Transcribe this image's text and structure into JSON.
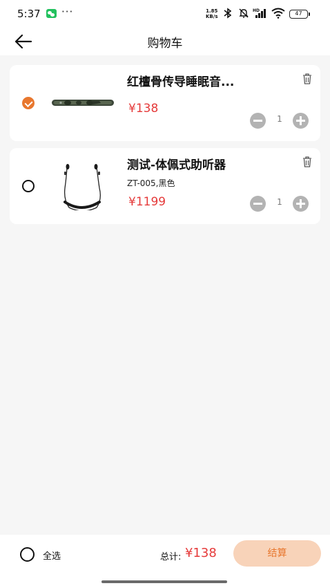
{
  "status_bar": {
    "time": "5:37",
    "more": "···",
    "net_speed_value": "1.85",
    "net_speed_unit": "KB/s",
    "battery": "47",
    "icons": [
      "wechat-icon",
      "bluetooth-icon",
      "mute-icon",
      "signal-hd-icon",
      "wifi-icon",
      "battery-icon"
    ]
  },
  "header": {
    "title": "购物车",
    "back_icon": "arrow-left-icon"
  },
  "cart": {
    "items": [
      {
        "title": "红檀骨传导睡眠音...",
        "spec": "",
        "price": "¥138",
        "quantity": "1",
        "checked": true,
        "image": "bone-conduction-headband"
      },
      {
        "title": "测试-体佩式助听器",
        "spec": "ZT-005,黑色",
        "price": "¥1199",
        "quantity": "1",
        "checked": false,
        "image": "neckband-earphones"
      }
    ]
  },
  "footer": {
    "select_all_label": "全选",
    "total_label": "总计:",
    "total_value": "¥138",
    "checkout_label": "结算"
  },
  "colors": {
    "accent": "#e8772e",
    "price": "#e53a3a",
    "checkout_bg": "#f8d3b9",
    "page_bg": "#f6f6f6"
  }
}
